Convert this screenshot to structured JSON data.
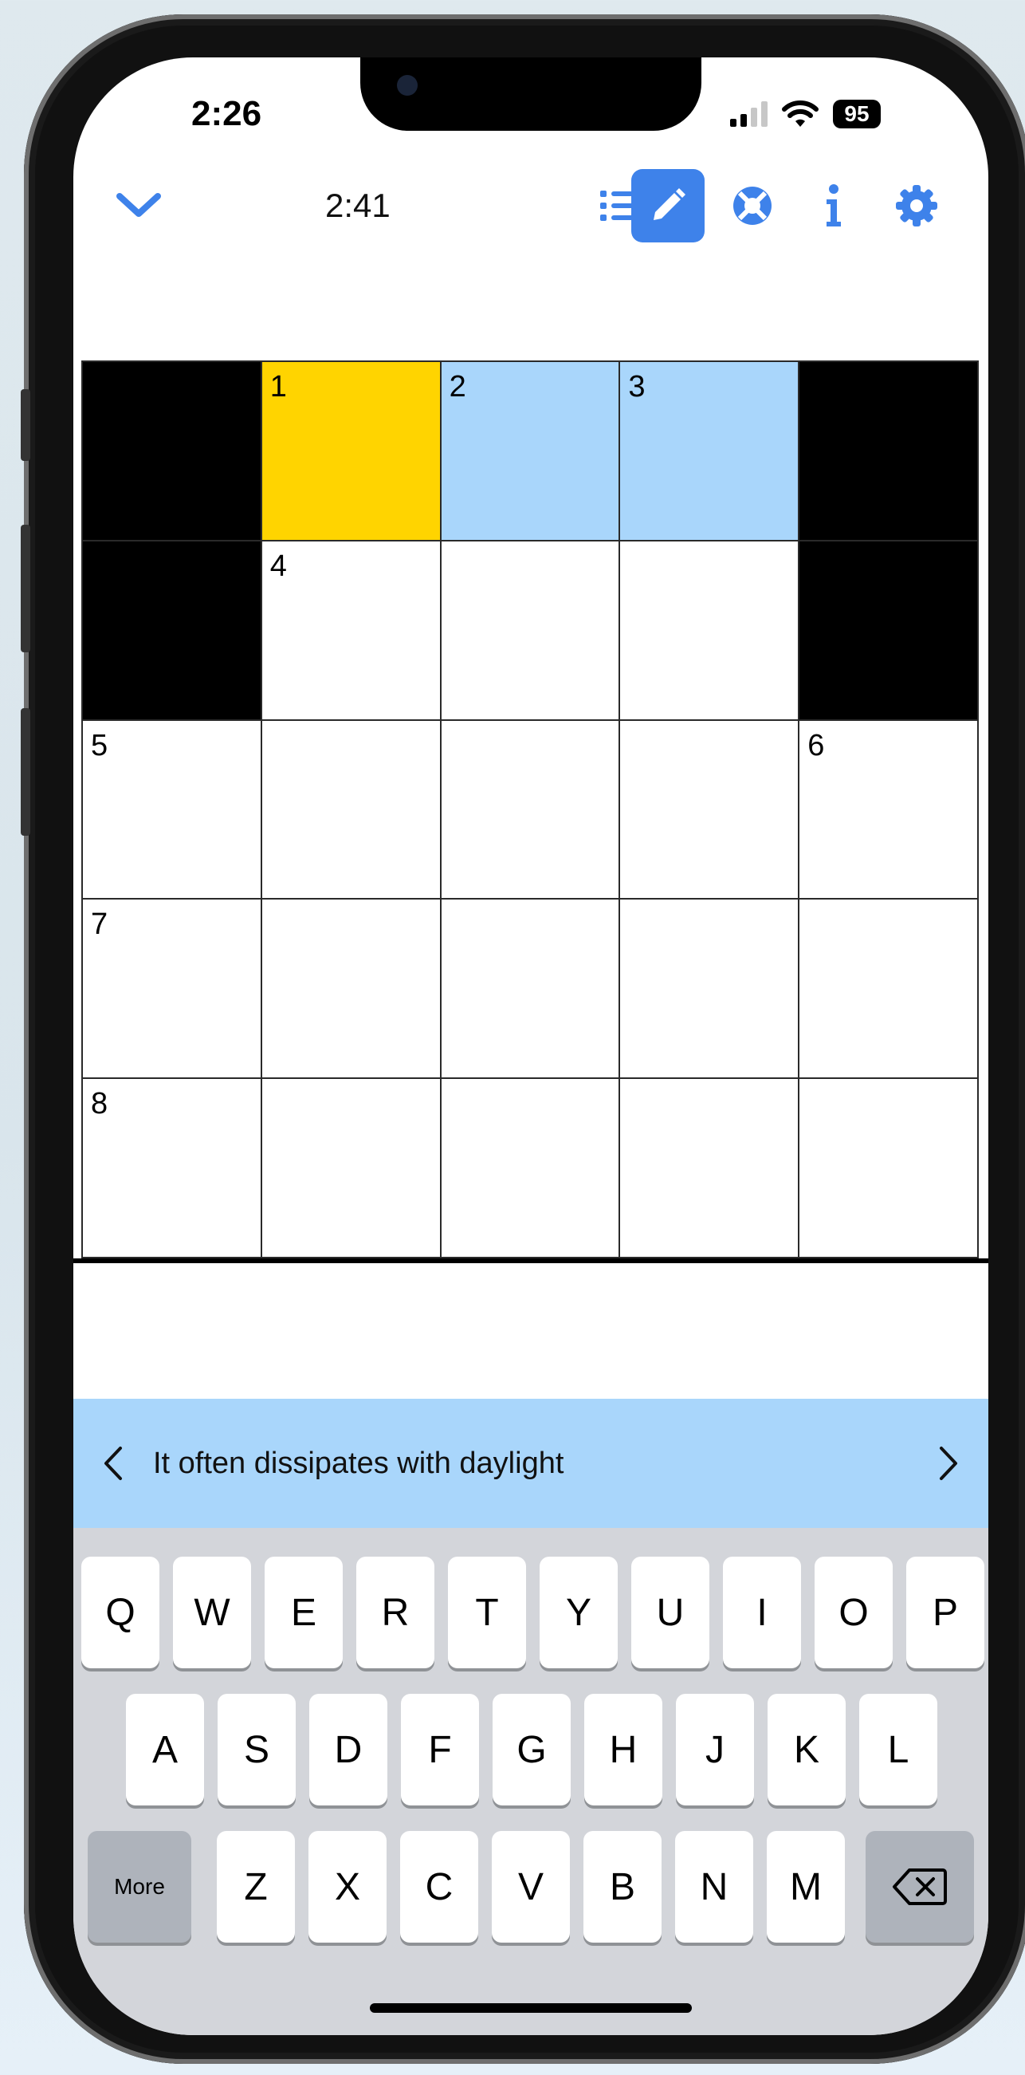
{
  "status_bar": {
    "time": "2:26",
    "battery": "95"
  },
  "toolbar": {
    "timer": "2:41",
    "icons": [
      "chevron-down-icon",
      "clue-list-icon",
      "pencil-icon",
      "help-lifebuoy-icon",
      "info-icon",
      "gear-icon"
    ],
    "active": "pencil-icon"
  },
  "grid": {
    "size": 5,
    "cells": [
      [
        {
          "t": "black"
        },
        {
          "t": "selected",
          "n": "1"
        },
        {
          "t": "highlight",
          "n": "2"
        },
        {
          "t": "highlight",
          "n": "3"
        },
        {
          "t": "black"
        }
      ],
      [
        {
          "t": "black"
        },
        {
          "t": "white",
          "n": "4"
        },
        {
          "t": "white"
        },
        {
          "t": "white"
        },
        {
          "t": "black"
        }
      ],
      [
        {
          "t": "white",
          "n": "5"
        },
        {
          "t": "white"
        },
        {
          "t": "white"
        },
        {
          "t": "white"
        },
        {
          "t": "white",
          "n": "6"
        }
      ],
      [
        {
          "t": "white",
          "n": "7"
        },
        {
          "t": "white"
        },
        {
          "t": "white"
        },
        {
          "t": "white"
        },
        {
          "t": "white"
        }
      ],
      [
        {
          "t": "white",
          "n": "8"
        },
        {
          "t": "white"
        },
        {
          "t": "white"
        },
        {
          "t": "white"
        },
        {
          "t": "white"
        }
      ]
    ]
  },
  "clue": {
    "text": "It often dissipates with daylight"
  },
  "keyboard": {
    "row1": [
      "Q",
      "W",
      "E",
      "R",
      "T",
      "Y",
      "U",
      "I",
      "O",
      "P"
    ],
    "row2": [
      "A",
      "S",
      "D",
      "F",
      "G",
      "H",
      "J",
      "K",
      "L"
    ],
    "row3": [
      "Z",
      "X",
      "C",
      "V",
      "B",
      "N",
      "M"
    ],
    "more_label": "More"
  },
  "colors": {
    "selected": "#ffd400",
    "highlight": "#a9d6fb",
    "accent": "#3e82ea"
  }
}
